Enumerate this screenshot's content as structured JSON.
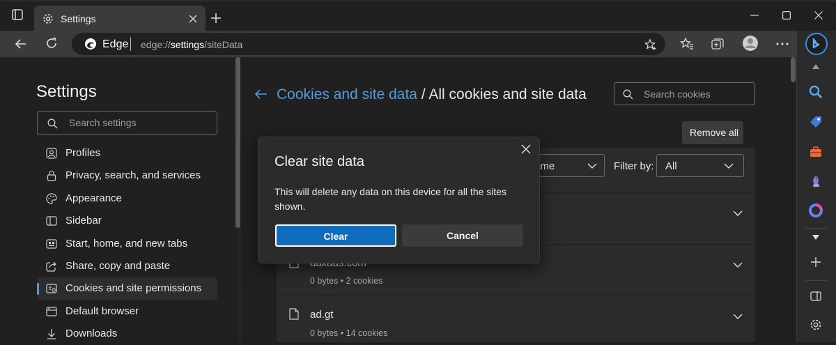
{
  "browser": {
    "tab_title": "Settings",
    "omnibox_label": "Edge",
    "url_prefix": "edge://",
    "url_main": "settings",
    "url_suffix": "/siteData"
  },
  "sidebar": {
    "title": "Settings",
    "search_placeholder": "Search settings",
    "items": [
      {
        "label": "Profiles",
        "icon": "profile-icon"
      },
      {
        "label": "Privacy, search, and services",
        "icon": "lock-icon"
      },
      {
        "label": "Appearance",
        "icon": "palette-icon"
      },
      {
        "label": "Sidebar",
        "icon": "sidebar-icon"
      },
      {
        "label": "Start, home, and new tabs",
        "icon": "home-icon"
      },
      {
        "label": "Share, copy and paste",
        "icon": "share-icon"
      },
      {
        "label": "Cookies and site permissions",
        "icon": "cookie-permissions-icon",
        "active": true
      },
      {
        "label": "Default browser",
        "icon": "browser-icon"
      },
      {
        "label": "Downloads",
        "icon": "download-icon"
      }
    ]
  },
  "main": {
    "breadcrumb_link": "Cookies and site data",
    "breadcrumb_sep": "/",
    "breadcrumb_current": "All cookies and site data",
    "search_placeholder": "Search cookies",
    "remove_all_label": "Remove all",
    "sort_value": "ame",
    "filter_label": "Filter by:",
    "filter_value": "All",
    "sites": [
      {
        "name": "aaxads.com",
        "detail": "0 bytes • 2 cookies"
      },
      {
        "name": "ad.gt",
        "detail": "0 bytes • 14 cookies"
      }
    ]
  },
  "dialog": {
    "title": "Clear site data",
    "message": "This will delete any data on this device for all the sites shown.",
    "clear_label": "Clear",
    "cancel_label": "Cancel"
  },
  "colors": {
    "accent": "#0f6cbd",
    "link": "#4f9ce2",
    "background": "#202020",
    "card": "#2b2b2b"
  }
}
